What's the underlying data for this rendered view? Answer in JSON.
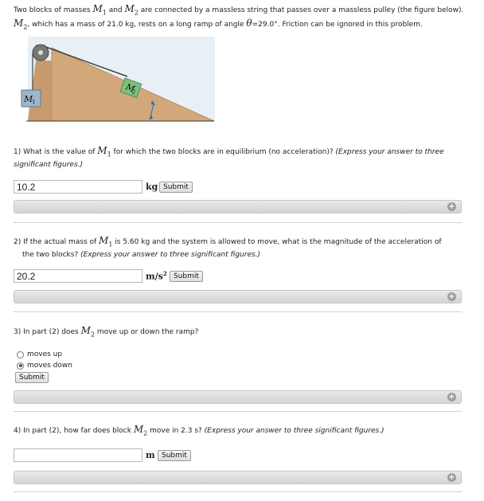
{
  "intro": {
    "line1a": "Two blocks of masses ",
    "m1": "M",
    "m1_sub": "1",
    "and": " and ",
    "m2": "M",
    "m2_sub": "2",
    "line1b": " are connected by a massless string that passes over a massless pulley (the figure below). ",
    "line1c": ", which has a mass of 21.0 kg, rests on a long ramp of angle ",
    "theta": "θ",
    "line1d": "=29.0°. Friction can be ignored in this problem."
  },
  "figure": {
    "m1_label": "M",
    "m1_sub": "1",
    "m2_label": "M",
    "m2_sub": "2",
    "colors": {
      "ramp": "#d2a77a",
      "block_m2": "#7cc07f",
      "block_m1": "#9fb5c9",
      "bg": "#e8f0f6"
    }
  },
  "q1": {
    "text_a": "1) What is the value of ",
    "text_b": " for which the two blocks are in equilibrium (no acceleration)? ",
    "hint": "(Express your answer to three significant figures.)",
    "answer": "10.2",
    "unit": "kg",
    "submit": "Submit"
  },
  "q2": {
    "text_a": "2) If the actual mass of ",
    "text_b": " is 5.60 kg and the system is allowed to move, what is the magnitude of the acceleration of",
    "text_c": "the two blocks? ",
    "hint": "(Express your answer to three significant figures.)",
    "answer": "20.2",
    "unit": "m/s",
    "unit_sup": "2",
    "submit": "Submit"
  },
  "q3": {
    "text_a": "3) In part (2) does ",
    "text_b": " move up or down the ramp?",
    "options": [
      "moves up",
      "moves down"
    ],
    "selected": "moves down",
    "submit": "Submit"
  },
  "q4": {
    "text_a": "4) In part (2), how far does block ",
    "text_b": " move in 2.3 s? ",
    "hint": "(Express your answer to three significant figures.)",
    "answer": "",
    "unit": "m",
    "submit": "Submit"
  },
  "expand_icon": "plus-circle-icon"
}
